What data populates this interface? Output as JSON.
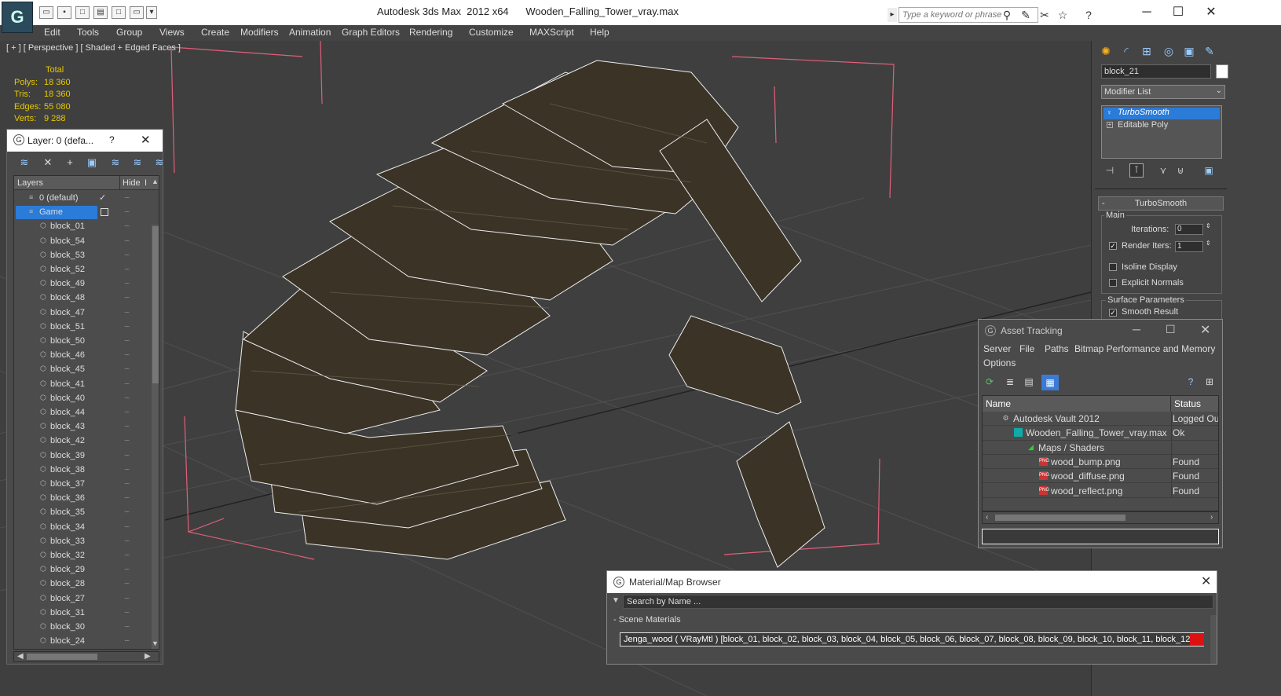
{
  "titlebar": {
    "app": "Autodesk 3ds Max  2012 x64",
    "file": "Wooden_Falling_Tower_vray.max",
    "search_placeholder": "Type a keyword or phrase"
  },
  "menu": [
    "Edit",
    "Tools",
    "Group",
    "Views",
    "Create",
    "Modifiers",
    "Animation",
    "Graph Editors",
    "Rendering",
    "Customize",
    "MAXScript",
    "Help"
  ],
  "viewport": {
    "label": "[ + ] [ Perspective ] [ Shaded + Edged Faces ]",
    "stats": {
      "header": "Total",
      "rows": [
        {
          "label": "Polys:",
          "value": "18 360"
        },
        {
          "label": "Tris:",
          "value": "18 360"
        },
        {
          "label": "Edges:",
          "value": "55 080"
        },
        {
          "label": "Verts:",
          "value": "9 288"
        }
      ]
    }
  },
  "layer_panel": {
    "title": "Layer: 0 (defa...",
    "help": "?",
    "col_layers": "Layers",
    "col_hide": "Hide",
    "col_f": "I",
    "rows": [
      "0 (default)",
      "Game",
      "block_01",
      "block_54",
      "block_53",
      "block_52",
      "block_49",
      "block_48",
      "block_47",
      "block_51",
      "block_50",
      "block_46",
      "block_45",
      "block_41",
      "block_40",
      "block_44",
      "block_43",
      "block_42",
      "block_39",
      "block_38",
      "block_37",
      "block_36",
      "block_35",
      "block_34",
      "block_33",
      "block_32",
      "block_29",
      "block_28",
      "block_27",
      "block_31",
      "block_30",
      "block_24"
    ]
  },
  "command_panel": {
    "object_name": "block_21",
    "modifier_list": "Modifier List",
    "stack": [
      "TurboSmooth",
      "Editable Poly"
    ],
    "rollout": "TurboSmooth",
    "group_main": "Main",
    "iterations_label": "Iterations:",
    "iterations_value": "0",
    "render_iters_label": "Render Iters:",
    "render_iters_value": "1",
    "isoline": "Isoline Display",
    "explicit": "Explicit Normals",
    "group_surface": "Surface Parameters",
    "smooth_result": "Smooth Result"
  },
  "asset_tracking": {
    "title": "Asset Tracking",
    "menu": [
      "Server",
      "File",
      "Paths",
      "Bitmap Performance and Memory",
      "Options"
    ],
    "col_name": "Name",
    "col_status": "Status",
    "rows": [
      {
        "name": "Autodesk Vault 2012",
        "status": "Logged Ou",
        "indent": 0
      },
      {
        "name": "Wooden_Falling_Tower_vray.max",
        "status": "Ok",
        "indent": 1
      },
      {
        "name": "Maps / Shaders",
        "status": "",
        "indent": 2
      },
      {
        "name": "wood_bump.png",
        "status": "Found",
        "indent": 3
      },
      {
        "name": "wood_diffuse.png",
        "status": "Found",
        "indent": 3
      },
      {
        "name": "wood_reflect.png",
        "status": "Found",
        "indent": 3
      }
    ]
  },
  "material_browser": {
    "title": "Material/Map Browser",
    "search_placeholder": "Search by Name ...",
    "section": "- Scene Materials",
    "entry": "Jenga_wood  ( VRayMtl ) [block_01, block_02, block_03, block_04, block_05, block_06, block_07, block_08, block_09, block_10, block_11, block_12,..."
  },
  "colors": {
    "accent_selection": "#2b7bd8",
    "stats_text": "#e8c800",
    "bbox_lines": "#e0607a",
    "wood_dark": "#3a3326"
  }
}
